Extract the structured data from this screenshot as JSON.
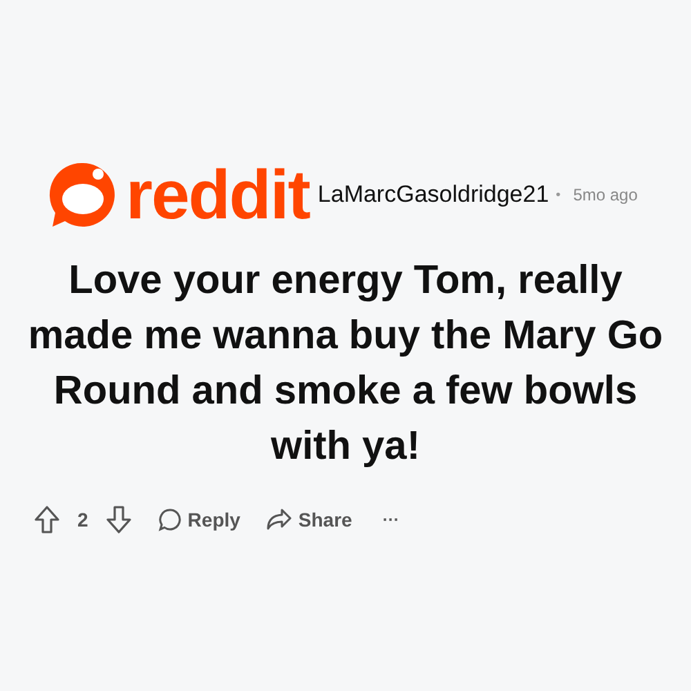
{
  "logo": {
    "wordmark": "reddit"
  },
  "comment": {
    "author": "LaMarcGasoldridge21",
    "separator": "•",
    "time": "5mo ago",
    "body": "Love your energy Tom, really made me wanna buy the Mary Go Round and smoke a few bowls with ya!"
  },
  "actions": {
    "score": "2",
    "reply": "Reply",
    "share": "Share",
    "more": "···"
  }
}
